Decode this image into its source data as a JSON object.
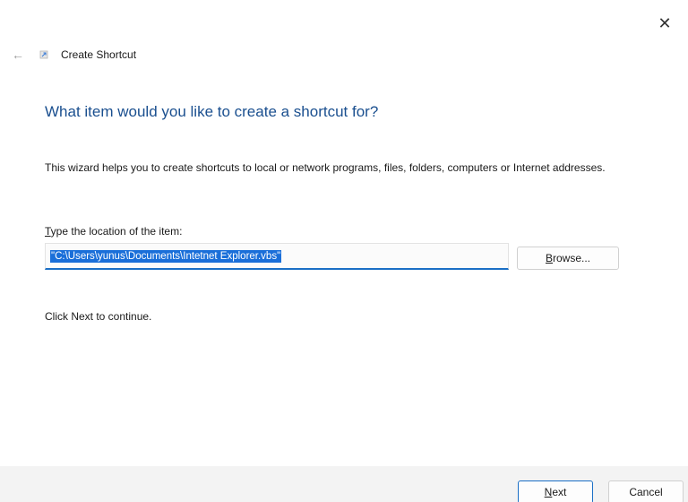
{
  "window": {
    "title": "Create Shortcut",
    "close_glyph": "✕",
    "back_glyph": "←",
    "back_icon": "arrow-left-icon",
    "app_icon": "shortcut-icon"
  },
  "content": {
    "heading": "What item would you like to create a shortcut for?",
    "description": "This wizard helps you to create shortcuts to local or network programs, files, folders, computers or Internet addresses.",
    "location_label_mnemonic": "T",
    "location_label_rest": "ype the location of the item:",
    "location_value": "\"C:\\Users\\yunus\\Documents\\Intetnet Explorer.vbs\"",
    "browse_mnemonic": "B",
    "browse_rest": "rowse...",
    "hint": "Click Next to continue."
  },
  "footer": {
    "next_mnemonic": "N",
    "next_rest": "ext",
    "cancel_label": "Cancel"
  },
  "colors": {
    "accent": "#1a6fc6",
    "heading": "#1a4f8f",
    "selection": "#1a6fd9",
    "footer_bg": "#f3f3f3"
  }
}
